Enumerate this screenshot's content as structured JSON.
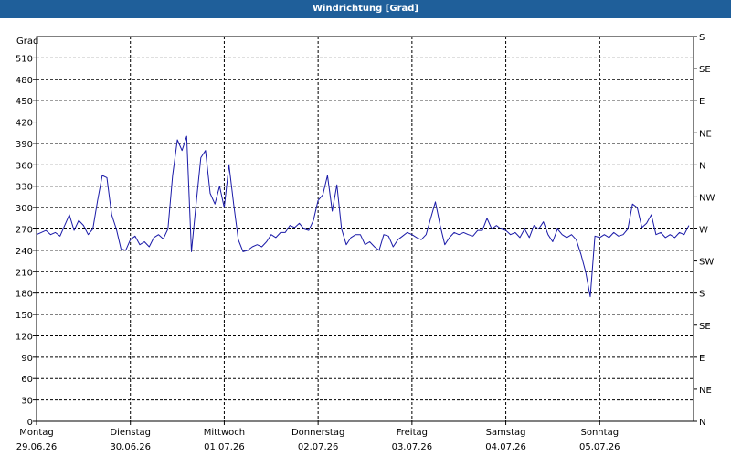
{
  "window": {
    "title": "Windrichtung [Grad]"
  },
  "chart_data": {
    "type": "line",
    "title": "Windrichtung [Grad]",
    "ylabel": "Grad",
    "xlabel": "",
    "ylim": [
      0,
      540
    ],
    "y_ticks": [
      0,
      30,
      60,
      90,
      120,
      150,
      180,
      210,
      240,
      270,
      300,
      330,
      360,
      390,
      420,
      450,
      480,
      510
    ],
    "right_axis_labels": [
      "N",
      "NE",
      "E",
      "SE",
      "S",
      "SW",
      "W",
      "NW",
      "N",
      "NE",
      "E",
      "SE",
      "S"
    ],
    "x_range": [
      0,
      7
    ],
    "x_ticks": [
      {
        "day": "Montag",
        "date": "29.06.26",
        "x": 0
      },
      {
        "day": "Dienstag",
        "date": "30.06.26",
        "x": 1
      },
      {
        "day": "Mittwoch",
        "date": "01.07.26",
        "x": 2
      },
      {
        "day": "Donnerstag",
        "date": "02.07.26",
        "x": 3
      },
      {
        "day": "Freitag",
        "date": "03.07.26",
        "x": 4
      },
      {
        "day": "Samstag",
        "date": "04.07.26",
        "x": 5
      },
      {
        "day": "Sonntag",
        "date": "05.07.26",
        "x": 6
      }
    ],
    "grid": true,
    "line_color": "#1a1aa8",
    "series": [
      {
        "name": "",
        "x": [
          0,
          0.05,
          0.1,
          0.15,
          0.2,
          0.25,
          0.3,
          0.35,
          0.4,
          0.45,
          0.5,
          0.55,
          0.6,
          0.65,
          0.7,
          0.75,
          0.8,
          0.85,
          0.9,
          0.95,
          1.0,
          1.05,
          1.1,
          1.15,
          1.2,
          1.25,
          1.3,
          1.35,
          1.4,
          1.45,
          1.5,
          1.55,
          1.6,
          1.65,
          1.7,
          1.75,
          1.8,
          1.85,
          1.9,
          1.95,
          2.0,
          2.05,
          2.1,
          2.15,
          2.2,
          2.25,
          2.3,
          2.35,
          2.4,
          2.45,
          2.5,
          2.55,
          2.6,
          2.65,
          2.7,
          2.75,
          2.8,
          2.85,
          2.9,
          2.95,
          3.0,
          3.05,
          3.1,
          3.15,
          3.2,
          3.25,
          3.3,
          3.35,
          3.4,
          3.45,
          3.5,
          3.55,
          3.6,
          3.65,
          3.7,
          3.75,
          3.8,
          3.85,
          3.9,
          3.95,
          4.0,
          4.05,
          4.1,
          4.15,
          4.2,
          4.25,
          4.3,
          4.35,
          4.4,
          4.45,
          4.5,
          4.55,
          4.6,
          4.65,
          4.7,
          4.75,
          4.8,
          4.85,
          4.9,
          4.95,
          5.0,
          5.05,
          5.1,
          5.15,
          5.2,
          5.25,
          5.3,
          5.35,
          5.4,
          5.45,
          5.5,
          5.55,
          5.6,
          5.65,
          5.7,
          5.75,
          5.8,
          5.85,
          5.9,
          5.95,
          6.0,
          6.05,
          6.1,
          6.15,
          6.2,
          6.25,
          6.3,
          6.35,
          6.4,
          6.45,
          6.5,
          6.55,
          6.6,
          6.65,
          6.7,
          6.75,
          6.8,
          6.85,
          6.9,
          6.95
        ],
        "values": [
          262,
          265,
          268,
          262,
          265,
          260,
          275,
          290,
          268,
          282,
          275,
          262,
          270,
          310,
          345,
          342,
          290,
          270,
          242,
          240,
          255,
          260,
          248,
          252,
          245,
          258,
          262,
          256,
          270,
          345,
          395,
          380,
          400,
          238,
          305,
          370,
          380,
          320,
          305,
          330,
          300,
          360,
          305,
          255,
          238,
          240,
          245,
          248,
          245,
          252,
          262,
          258,
          265,
          265,
          275,
          272,
          278,
          270,
          268,
          282,
          310,
          318,
          345,
          295,
          332,
          270,
          248,
          258,
          262,
          262,
          248,
          252,
          245,
          240,
          262,
          260,
          245,
          255,
          260,
          265,
          262,
          258,
          255,
          262,
          285,
          308,
          275,
          248,
          258,
          265,
          262,
          265,
          262,
          260,
          268,
          268,
          285,
          270,
          275,
          270,
          268,
          262,
          265,
          258,
          270,
          258,
          275,
          270,
          280,
          262,
          252,
          270,
          262,
          258,
          262,
          255,
          235,
          210,
          175,
          260,
          258,
          262,
          258,
          265,
          260,
          262,
          270,
          305,
          300,
          272,
          278,
          290,
          262,
          265,
          258,
          262,
          258,
          265,
          262,
          275
        ]
      }
    ]
  }
}
